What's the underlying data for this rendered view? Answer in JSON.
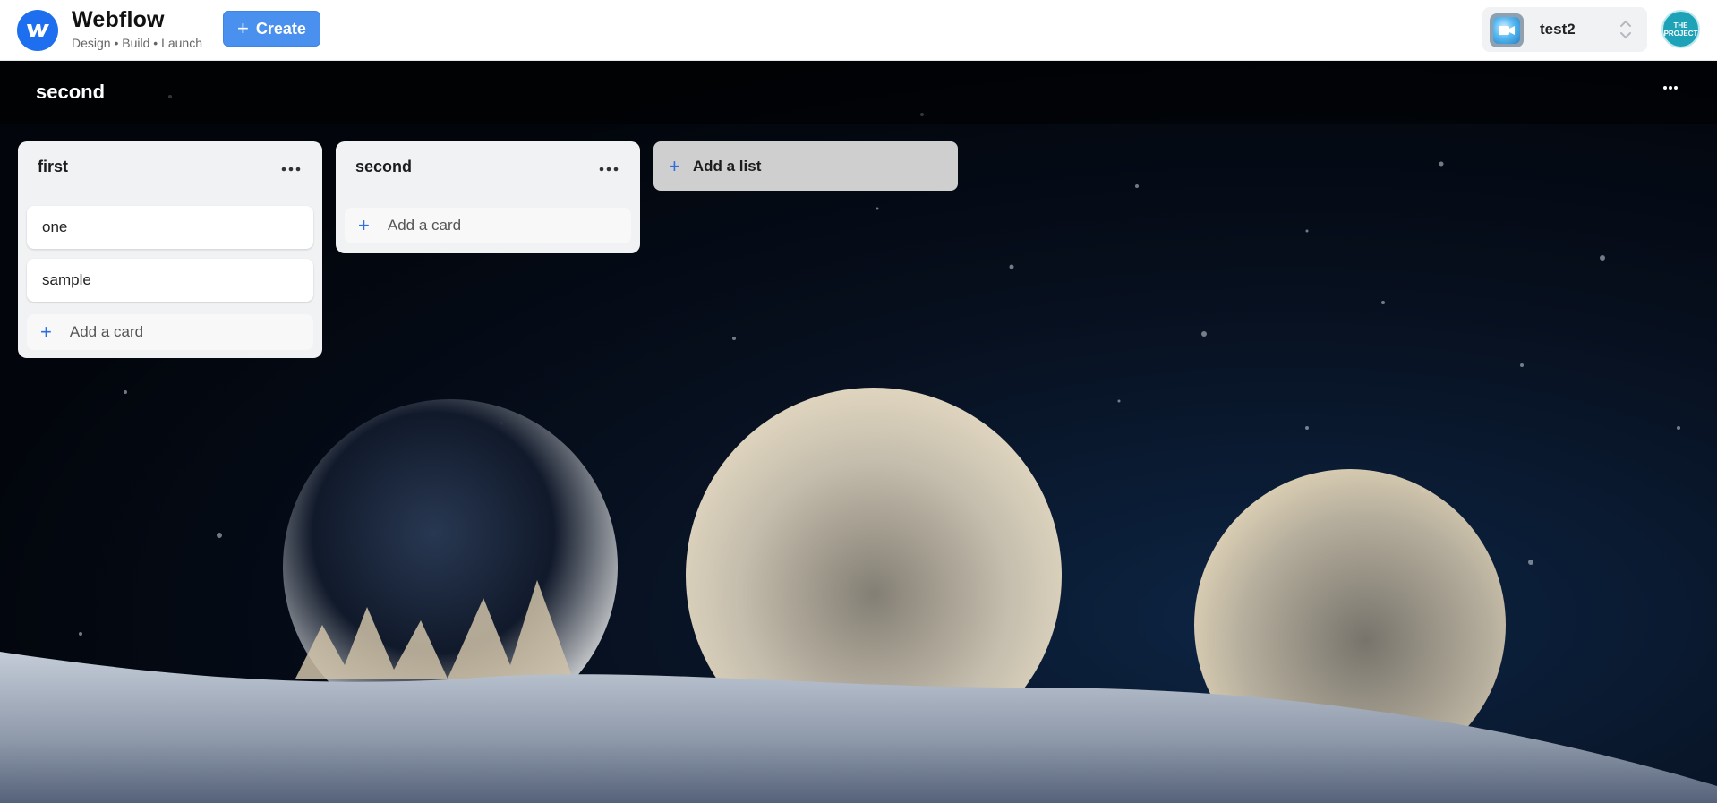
{
  "app": {
    "name": "Webflow",
    "tagline": "Design • Build • Launch",
    "create_label": "Create"
  },
  "workspace": {
    "name": "test2"
  },
  "user": {
    "avatar_text": "THE PROJECT"
  },
  "board": {
    "title": "second",
    "menu_label": "..."
  },
  "lists": [
    {
      "title": "first",
      "cards": [
        "one",
        "sample"
      ],
      "add_card_label": "Add a card"
    },
    {
      "title": "second",
      "cards": [],
      "add_card_label": "Add a card"
    }
  ],
  "add_list_label": "Add a list",
  "icons": [
    "webflow-logo-icon",
    "plus-icon",
    "workspace-video-icon",
    "chevron-updown-icon",
    "more-horizontal-icon"
  ],
  "colors": {
    "accent": "#4a90ee",
    "logo": "#1e6ff0",
    "plus": "#2f6fdc",
    "list_bg": "#f1f2f4",
    "add_list_bg": "#cfcfcf"
  }
}
